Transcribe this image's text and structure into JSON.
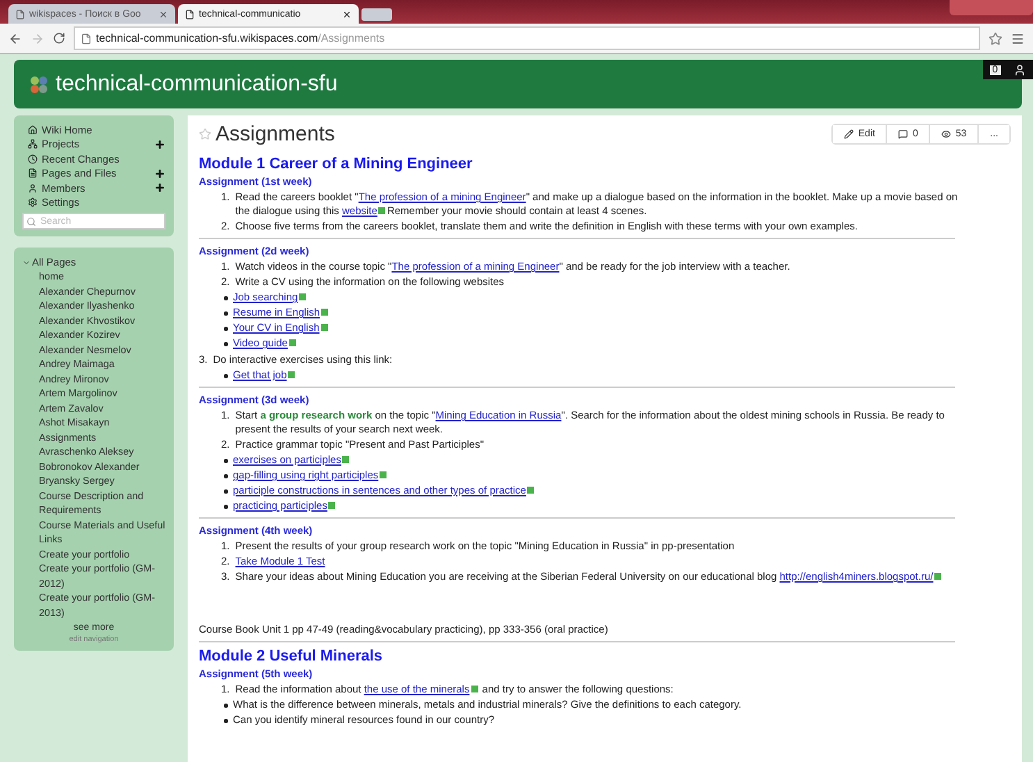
{
  "browser": {
    "tabs": [
      {
        "label": "wikispaces - Поиск в Goo",
        "selected": false
      },
      {
        "label": "technical-communicatio",
        "selected": true
      }
    ],
    "address": {
      "host": "technical-communication-sfu.wikispaces.com",
      "path": "/Assignments"
    }
  },
  "site": {
    "title": "technical-communication-sfu",
    "counter": "0"
  },
  "nav": [
    {
      "label": "Wiki Home",
      "has_add": false
    },
    {
      "label": "Projects",
      "has_add": true
    },
    {
      "label": "Recent Changes",
      "has_add": false
    },
    {
      "label": "Pages and Files",
      "has_add": true
    },
    {
      "label": "Members",
      "has_add": true
    },
    {
      "label": "Settings",
      "has_add": false
    }
  ],
  "search": {
    "placeholder": "Search"
  },
  "all_pages": {
    "heading": "All Pages",
    "expanded": true,
    "items": [
      "home",
      "Alexander Chepurnov",
      "Alexander Ilyashenko",
      "Alexander Khvostikov",
      "Alexander Kozirev",
      "Alexander Nesmelov",
      "Andrey Maimaga",
      "Andrey Mironov",
      "Artem Margolinov",
      "Artem Zavalov",
      "Ashot Misakayn",
      "Assignments",
      "Avraschenko Aleksey",
      "Bobronokov Alexander",
      "Bryansky Sergey",
      "Course Description and Requirements",
      "Course Materials and Useful Links",
      "Create your portfolio",
      "Create your portfolio (GM-2012)",
      "Create your portfolio (GM-2013)"
    ],
    "see_more": "see more",
    "edit_navigation": "edit navigation"
  },
  "page": {
    "title": "Assignments",
    "actions": [
      {
        "kind": "edit",
        "label": "Edit"
      },
      {
        "kind": "comments",
        "label": "0"
      },
      {
        "kind": "views",
        "label": "53"
      },
      {
        "kind": "more",
        "label": "..."
      }
    ],
    "blocks": [
      {
        "kind": "h2",
        "text": "Module 1 Career of a Mining Engineer"
      },
      {
        "kind": "h3",
        "text": "Assignment (1st week)"
      },
      {
        "kind": "ol",
        "num": "1.",
        "segments": [
          {
            "kind": "text",
            "text": "Read the careers booklet \""
          },
          {
            "kind": "link",
            "text": "The profession of a mining Engineer"
          },
          {
            "kind": "text",
            "text": "\" and make up a dialogue based on the information in the booklet. Make up a movie based on the dialogue using this "
          },
          {
            "kind": "external",
            "text": "website"
          },
          {
            "kind": "text",
            "text": "Remember your movie should contain at least 4 scenes."
          }
        ]
      },
      {
        "kind": "ol",
        "num": "2.",
        "segments": [
          {
            "kind": "text",
            "text": "Choose five terms from the careers booklet, translate them and write the definition in English with these terms with your own examples."
          }
        ]
      },
      {
        "kind": "rule"
      },
      {
        "kind": "h3",
        "text": "Assignment (2d week)"
      },
      {
        "kind": "ol",
        "num": "1.",
        "segments": [
          {
            "kind": "text",
            "text": "Watch videos in the course topic \""
          },
          {
            "kind": "link",
            "text": "The profession of a mining Engineer"
          },
          {
            "kind": "text",
            "text": "\" and be ready for the job interview with a teacher."
          }
        ]
      },
      {
        "kind": "ol",
        "num": "2.",
        "segments": [
          {
            "kind": "text",
            "text": "Write a CV using the information on the following websites"
          }
        ]
      },
      {
        "kind": "ul",
        "segments": [
          {
            "kind": "external",
            "text": "Job searching"
          }
        ]
      },
      {
        "kind": "ul",
        "segments": [
          {
            "kind": "external",
            "text": "Resume in English"
          }
        ]
      },
      {
        "kind": "ul",
        "segments": [
          {
            "kind": "external",
            "text": "Your CV in English"
          }
        ]
      },
      {
        "kind": "ul",
        "segments": [
          {
            "kind": "external",
            "text": "Video guide"
          }
        ]
      },
      {
        "kind": "p",
        "num": "3.",
        "segments": [
          {
            "kind": "text",
            "text": "Do interactive exercises using this link:"
          }
        ]
      },
      {
        "kind": "ul",
        "segments": [
          {
            "kind": "external",
            "text": "Get that job"
          }
        ]
      },
      {
        "kind": "rule"
      },
      {
        "kind": "h3",
        "text": "Assignment (3d week)"
      },
      {
        "kind": "ol",
        "num": "1.",
        "segments": [
          {
            "kind": "text",
            "text": "Start "
          },
          {
            "kind": "strong",
            "text": "a group research work"
          },
          {
            "kind": "text",
            "text": " on the topic \""
          },
          {
            "kind": "link",
            "text": "Mining Education in Russia"
          },
          {
            "kind": "text",
            "text": "\". Search for the information about the oldest mining schools in Russia. Be ready to present the results of your search next week."
          }
        ]
      },
      {
        "kind": "ol",
        "num": "2.",
        "segments": [
          {
            "kind": "text",
            "text": "Practice grammar topic \"Present and Past Participles\""
          }
        ]
      },
      {
        "kind": "ul",
        "segments": [
          {
            "kind": "external",
            "text": "exercises on participles"
          }
        ]
      },
      {
        "kind": "ul",
        "segments": [
          {
            "kind": "external",
            "text": "gap-filling using right participles"
          }
        ]
      },
      {
        "kind": "ul",
        "segments": [
          {
            "kind": "external",
            "text": "participle constructions in sentences and other types of practice"
          }
        ]
      },
      {
        "kind": "ul",
        "segments": [
          {
            "kind": "external",
            "text": "practicing participles"
          }
        ]
      },
      {
        "kind": "rule"
      },
      {
        "kind": "h3",
        "text": "Assignment (4th week)"
      },
      {
        "kind": "ol",
        "num": "1.",
        "segments": [
          {
            "kind": "text",
            "text": "Present the results of your group research work on the topic \"Mining Education in Russia\" in pp-presentation"
          }
        ]
      },
      {
        "kind": "ol",
        "num": "2.",
        "segments": [
          {
            "kind": "link",
            "text": "Take Module 1 Test"
          }
        ]
      },
      {
        "kind": "ol",
        "num": "3.",
        "segments": [
          {
            "kind": "text",
            "text": "Share your ideas about Mining Education you are receiving at the Siberian Federal University on our educational blog "
          },
          {
            "kind": "external",
            "text": "http://english4miners.blogspot.ru/"
          }
        ]
      },
      {
        "kind": "note",
        "segments": [
          {
            "kind": "text",
            "text": "Course Book Unit 1 pp 47-49 (reading&vocabulary practicing), pp 333-356 (oral practice)"
          }
        ]
      },
      {
        "kind": "rule"
      },
      {
        "kind": "h2",
        "text": "Module 2 Useful Minerals"
      },
      {
        "kind": "h3",
        "text": "Assignment (5th week)"
      },
      {
        "kind": "ol",
        "num": "1.",
        "segments": [
          {
            "kind": "text",
            "text": "Read the information about "
          },
          {
            "kind": "external",
            "text": "the use of the minerals"
          },
          {
            "kind": "text",
            "text": " and try to answer the following questions:"
          }
        ]
      },
      {
        "kind": "ul",
        "segments": [
          {
            "kind": "text",
            "text": "What is the difference between minerals, metals and industrial minerals? Give the definitions to each category."
          }
        ]
      },
      {
        "kind": "ul",
        "segments": [
          {
            "kind": "text",
            "text": "Can you identify mineral resources found in our country?"
          }
        ]
      }
    ]
  }
}
